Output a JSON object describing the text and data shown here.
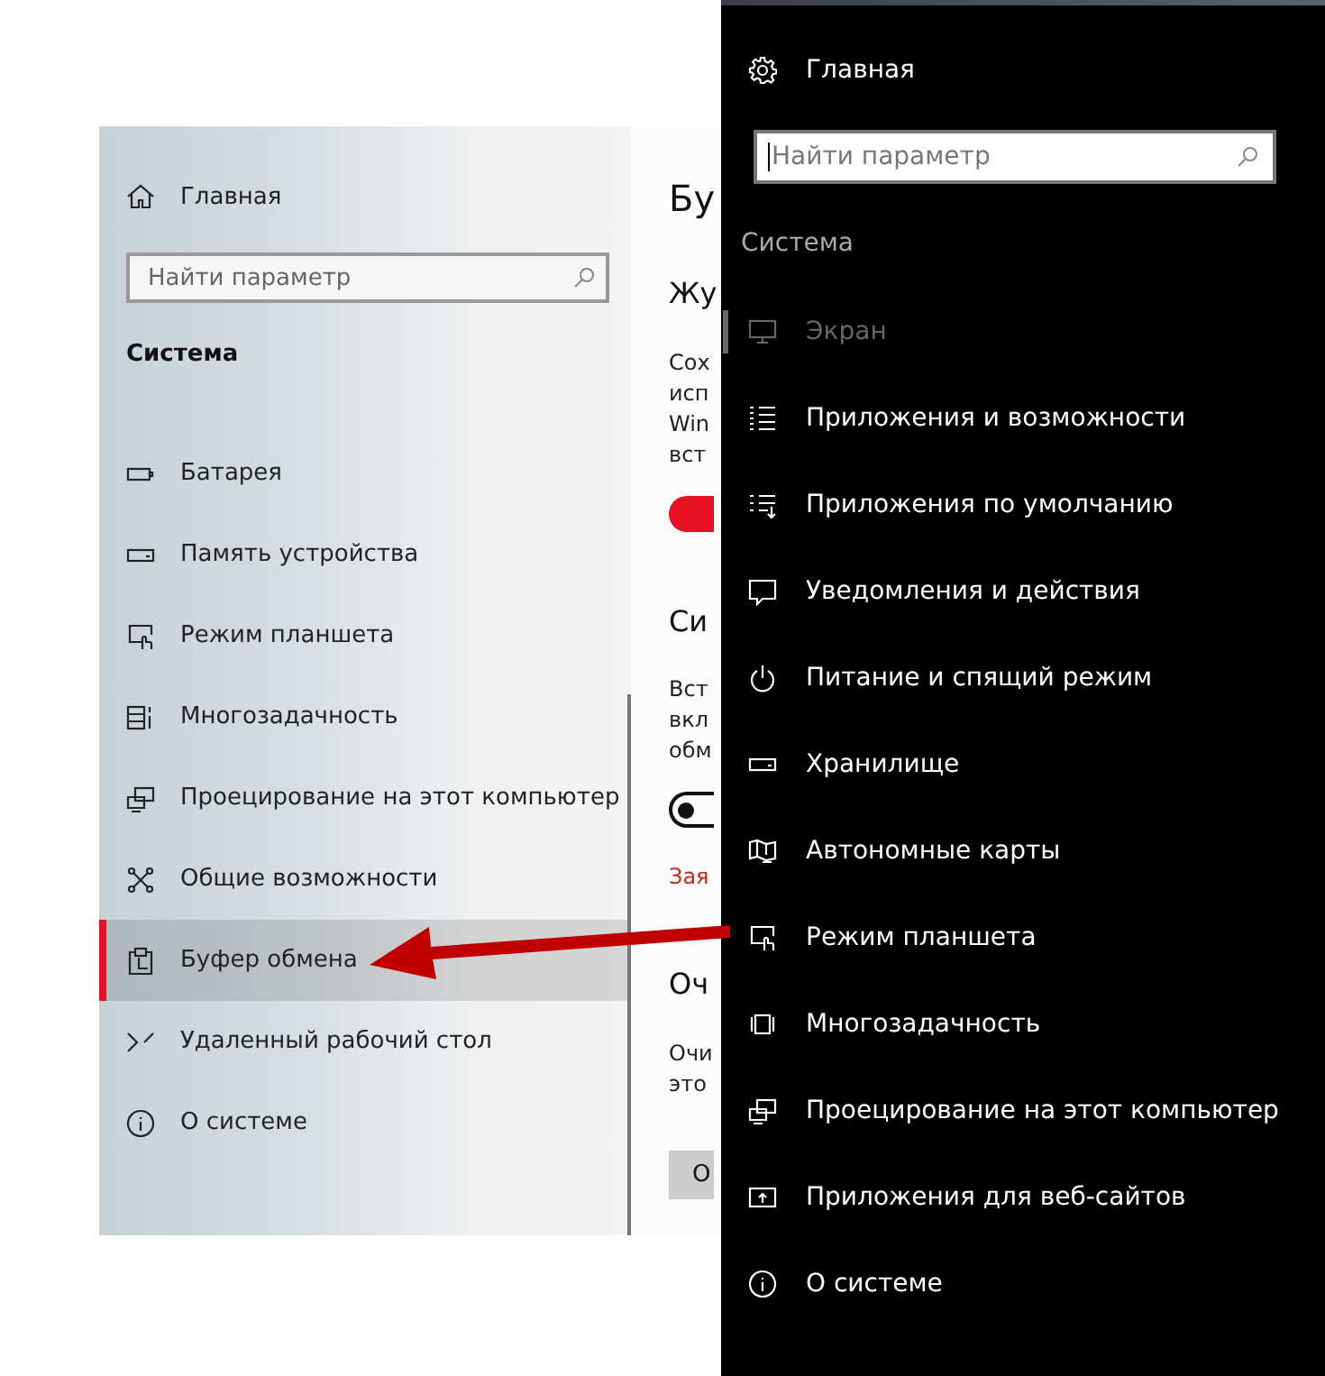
{
  "left_panel": {
    "home": "Главная",
    "search": {
      "placeholder": "Найти параметр"
    },
    "section": "Система",
    "items": [
      {
        "label": "Батарея",
        "selected": false
      },
      {
        "label": "Память устройства",
        "selected": false
      },
      {
        "label": "Режим планшета",
        "selected": false
      },
      {
        "label": "Многозадачность",
        "selected": false
      },
      {
        "label": "Проецирование на этот компьютер",
        "selected": false
      },
      {
        "label": "Общие возможности",
        "selected": false
      },
      {
        "label": "Буфер обмена",
        "selected": true
      },
      {
        "label": "Удаленный рабочий стол",
        "selected": false
      },
      {
        "label": "О системе",
        "selected": false
      }
    ]
  },
  "content": {
    "title": "Бу",
    "subheading_1": "Жу",
    "paragraph_1": [
      "Сох",
      "исп",
      "Win",
      "вст"
    ],
    "toggle_1": {
      "on": true
    },
    "subheading_2": "Си",
    "paragraph_2": [
      "Вст",
      "вкл",
      "обм"
    ],
    "toggle_2": {
      "on": false
    },
    "link": "Зая",
    "subheading_3": "Оч",
    "paragraph_3": [
      "Очи",
      "это"
    ],
    "button": "О"
  },
  "right_panel": {
    "home": "Главная",
    "search": {
      "placeholder": "Найти параметр"
    },
    "section": "Система",
    "items": [
      {
        "label": "Экран",
        "selected": true
      },
      {
        "label": "Приложения и возможности",
        "selected": false
      },
      {
        "label": "Приложения по умолчанию",
        "selected": false
      },
      {
        "label": "Уведомления и действия",
        "selected": false
      },
      {
        "label": "Питание и спящий режим",
        "selected": false
      },
      {
        "label": "Хранилище",
        "selected": false
      },
      {
        "label": "Автономные карты",
        "selected": false
      },
      {
        "label": "Режим планшета",
        "selected": false
      },
      {
        "label": "Многозадачность",
        "selected": false
      },
      {
        "label": "Проецирование на этот компьютер",
        "selected": false
      },
      {
        "label": "Приложения для веб-сайтов",
        "selected": false
      },
      {
        "label": "О системе",
        "selected": false
      }
    ]
  }
}
